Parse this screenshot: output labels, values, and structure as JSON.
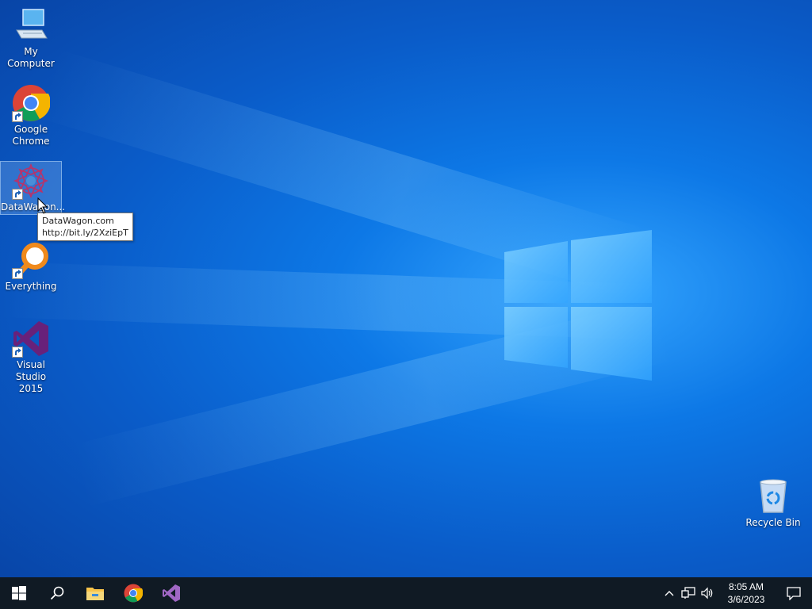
{
  "desktop": {
    "icons": [
      {
        "label": "My Computer",
        "icon": "computer-icon"
      },
      {
        "label": "Google\nChrome",
        "icon": "chrome-icon"
      },
      {
        "label": "DataWagon...",
        "icon": "datawagon-icon"
      },
      {
        "label": "Everything",
        "icon": "everything-icon"
      },
      {
        "label": "Visual Studio\n2015",
        "icon": "visual-studio-icon"
      },
      {
        "label": "Recycle Bin",
        "icon": "recycle-bin-icon"
      }
    ],
    "tooltip": {
      "line1": "DataWagon.com",
      "line2": "http://bit.ly/2XziEpT"
    }
  },
  "taskbar": {
    "pinned": [
      "start-icon",
      "search-icon",
      "file-explorer-icon",
      "chrome-icon",
      "visual-studio-icon"
    ],
    "clock": {
      "time": "8:05 AM",
      "date": "3/6/2023"
    }
  },
  "colors": {
    "taskbar": "#101a24",
    "accent": "#0a78e6"
  }
}
